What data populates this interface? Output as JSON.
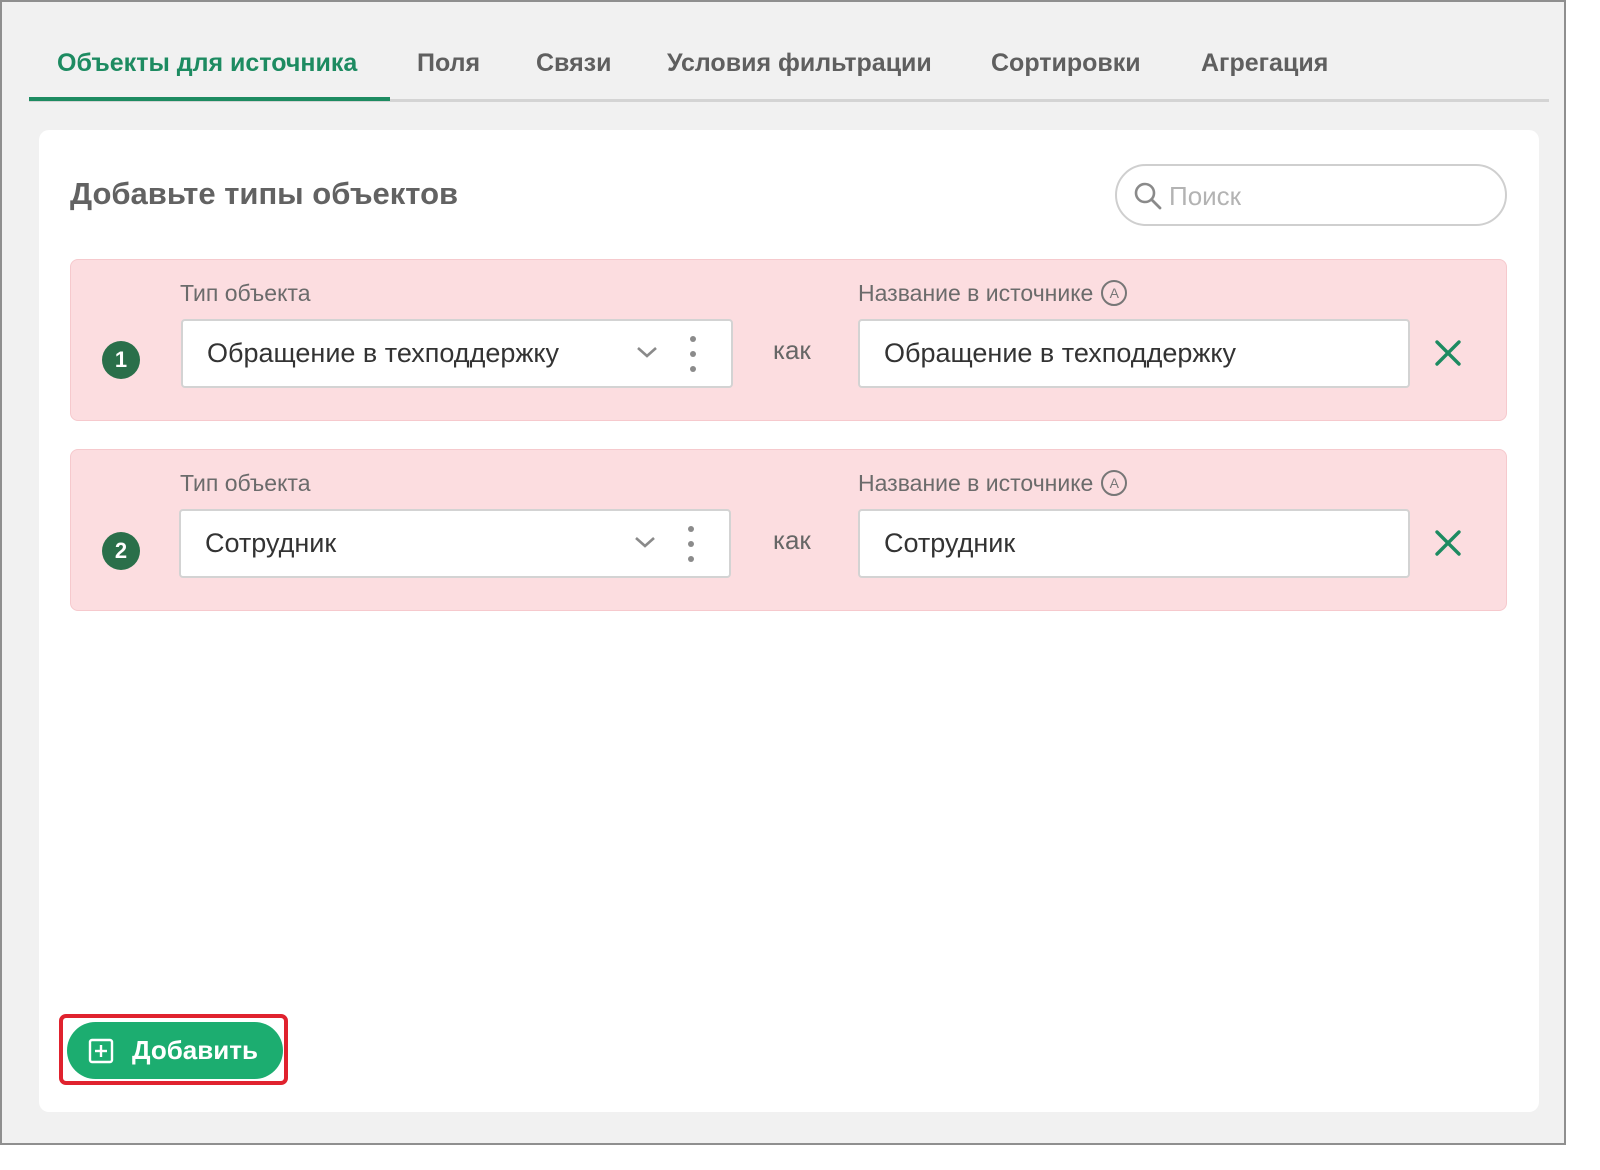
{
  "tabs": [
    {
      "label": "Объекты для источника",
      "active": true
    },
    {
      "label": "Поля",
      "active": false
    },
    {
      "label": "Связи",
      "active": false
    },
    {
      "label": "Условия фильтрации",
      "active": false
    },
    {
      "label": "Сортировки",
      "active": false
    },
    {
      "label": "Агрегация",
      "active": false
    }
  ],
  "panel": {
    "title": "Добавьте типы объектов",
    "search": {
      "placeholder": "Поиск",
      "value": "",
      "icon": "search-icon"
    }
  },
  "rows": [
    {
      "number": "1",
      "type_label": "Тип объекта",
      "type_value": "Обращение в техподдержку",
      "separator": "как",
      "name_label": "Название в источнике",
      "name_label_icon": "Ⓐ",
      "name_value": "Обращение в техподдержку"
    },
    {
      "number": "2",
      "type_label": "Тип объекта",
      "type_value": "Сотрудник",
      "separator": "как",
      "name_label": "Название в источнике",
      "name_label_icon": "Ⓐ",
      "name_value": "Сотрудник"
    }
  ],
  "add_button": {
    "label": "Добавить",
    "icon": "plus-square-icon"
  },
  "colors": {
    "accent": "#1d8b61",
    "button": "#1cad70",
    "row_error_bg": "#fcdde0",
    "number_badge": "#2a6f4a",
    "highlight": "#e0222e"
  }
}
